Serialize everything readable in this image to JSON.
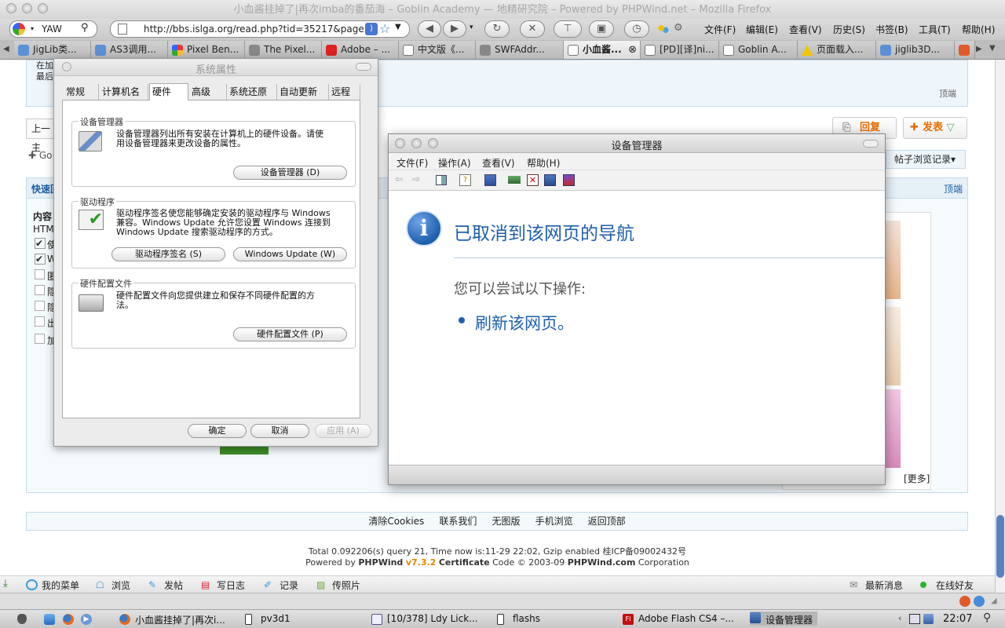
{
  "firefox": {
    "title": "小血酱挂掉了|再次imba的番茄海 – Goblin Academy — 地精研究院 – Powered by PHPWind.net – Mozilla Firefox",
    "search_value": "YAW",
    "url": "http://bbs.islga.org/read.php?tid=35217&page",
    "menu": [
      "文件(F)",
      "编辑(E)",
      "查看(V)",
      "历史(S)",
      "书签(B)",
      "工具(T)",
      "帮助(H)"
    ],
    "tabs": [
      "JigLib类...",
      "AS3调用...",
      "Pixel Ben...",
      "The Pixel...",
      "Adobe – ...",
      "中文版《...",
      "SWFAddr...",
      "小血酱...",
      "[PD][译]ni...",
      "Goblin A...",
      "页面载入...",
      "jiglib3D..."
    ]
  },
  "forum": {
    "left_fragments": [
      "在加",
      "最后",
      "上一主",
      "Go",
      "快速回",
      "内容",
      "HTML",
      "使",
      "W",
      "匿",
      "隐",
      "隐",
      "出",
      "加"
    ],
    "top_link": "顶端",
    "reply_button": "回复",
    "post_button": "发表",
    "history_button": "帖子浏览记录",
    "more_link": "[更多]",
    "footer_links": [
      "清除Cookies",
      "联系我们",
      "无图版",
      "手机浏览",
      "返回顶部"
    ],
    "stats_line": "Total 0.092206(s) query 21, Time now is:11-29 22:02, Gzip enabled 桂ICP备09002432号",
    "powered_prefix": "Powered by ",
    "powered_brand": "PHPWind",
    "powered_version": "v7.3.2",
    "powered_cert": "Certificate",
    "powered_code": "Code © 2003-09",
    "powered_site": "PHPWind.com",
    "powered_suffix": "Corporation",
    "bottom_items": [
      "我的菜单",
      "浏览",
      "发帖",
      "写日志",
      "记录",
      "传照片"
    ],
    "bottom_right": [
      "最新消息",
      "在线好友"
    ]
  },
  "system_properties": {
    "title": "系统属性",
    "tabs": [
      "常规",
      "计算机名",
      "硬件",
      "高级",
      "系统还原",
      "自动更新",
      "远程"
    ],
    "device_group": {
      "title": "设备管理器",
      "desc_line1": "设备管理器列出所有安装在计算机上的硬件设备。请使",
      "desc_line2": "用设备管理器来更改设备的属性。",
      "button": "设备管理器 (D)"
    },
    "driver_group": {
      "title": "驱动程序",
      "desc_line1": "驱动程序签名使您能够确定安装的驱动程序与 Windows",
      "desc_line2": "兼容。Windows Update 允许您设置 Windows 连接到",
      "desc_line3": "Windows Update 搜索驱动程序的方式。",
      "sign_button": "驱动程序签名 (S)",
      "update_button": "Windows Update (W)"
    },
    "profile_group": {
      "title": "硬件配置文件",
      "desc_line1": "硬件配置文件向您提供建立和保存不同硬件配置的方",
      "desc_line2": "法。",
      "button": "硬件配置文件 (P)"
    },
    "ok": "确定",
    "cancel": "取消",
    "apply": "应用 (A)"
  },
  "device_manager": {
    "title": "设备管理器",
    "menu": [
      "文件(F)",
      "操作(A)",
      "查看(V)",
      "帮助(H)"
    ],
    "heading": "已取消到该网页的导航",
    "subheading": "您可以尝试以下操作:",
    "action": "刷新该网页。"
  },
  "dock": {
    "items": [
      "小血酱挂掉了|再次i...",
      "pv3d1",
      "[10/378] Ldy Lick...",
      "flashs",
      "Adobe Flash CS4 –...",
      "设备管理器"
    ],
    "clock": "22:07"
  },
  "colors": {
    "accent": "#1a5fa8",
    "info_blue": "#1e5fae",
    "phpwind_orange": "#e08a00"
  }
}
